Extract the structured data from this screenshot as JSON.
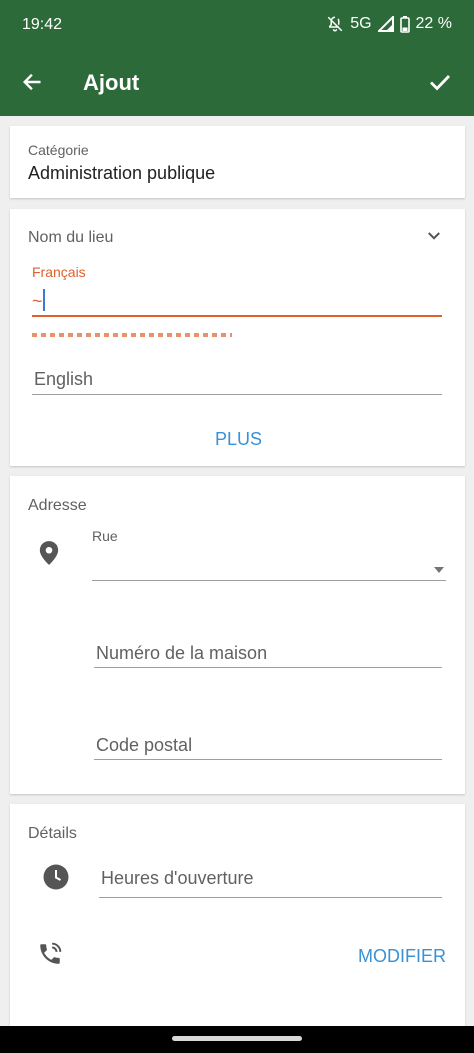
{
  "status": {
    "time": "19:42",
    "network": "5G",
    "battery": "22 %"
  },
  "appbar": {
    "title": "Ajout"
  },
  "category": {
    "label": "Catégorie",
    "value": "Administration publique"
  },
  "place_name": {
    "title": "Nom du lieu",
    "french_label": "Français",
    "french_value": "~",
    "english_placeholder": "English",
    "more_button": "PLUS"
  },
  "address": {
    "title": "Adresse",
    "street_label": "Rue",
    "house_number_placeholder": "Numéro de la maison",
    "postal_code_placeholder": "Code postal"
  },
  "details": {
    "title": "Détails",
    "hours_placeholder": "Heures d'ouverture",
    "modify_button": "MODIFIER"
  },
  "colors": {
    "primary": "#2d6a3a",
    "error": "#e0602d",
    "accent": "#3a91d6"
  }
}
